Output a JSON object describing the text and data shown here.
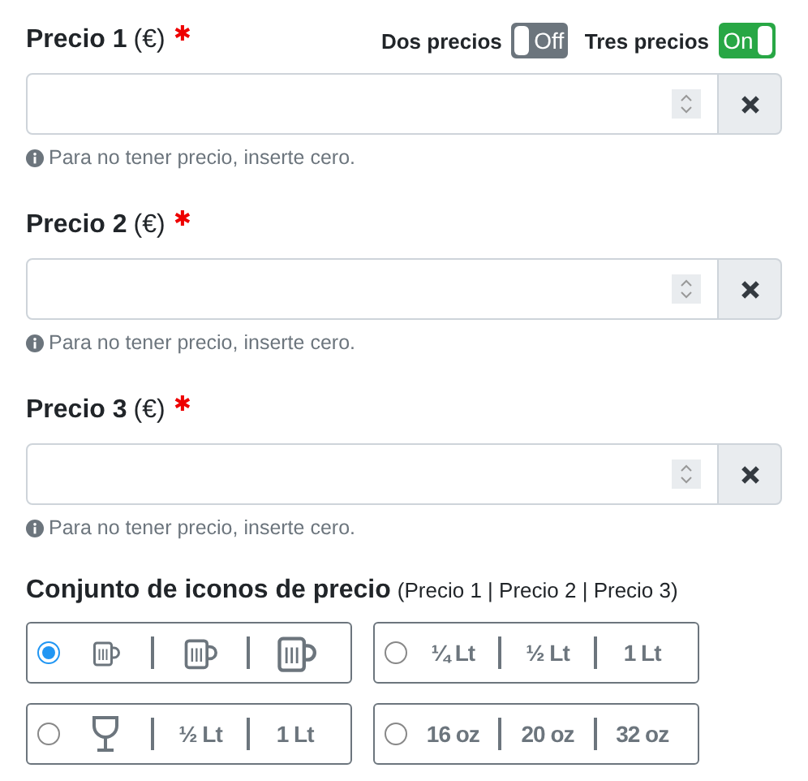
{
  "toggles": [
    {
      "label": "Dos precios",
      "on": false,
      "state_text": "Off"
    },
    {
      "label": "Tres precios",
      "on": true,
      "state_text": "On"
    }
  ],
  "prices": [
    {
      "label": "Precio 1",
      "unit": "(€)",
      "required_mark": "✱",
      "hint": "Para no tener precio, inserte cero."
    },
    {
      "label": "Precio 2",
      "unit": "(€)",
      "required_mark": "✱",
      "hint": "Para no tener precio, inserte cero."
    },
    {
      "label": "Precio 3",
      "unit": "(€)",
      "required_mark": "✱",
      "hint": "Para no tener precio, inserte cero."
    }
  ],
  "icon_sets": {
    "title": "Conjunto de iconos de precio",
    "subtitle": "(Precio 1 | Precio 2 | Precio 3)",
    "options": [
      {
        "selected": true,
        "items": [
          {
            "kind": "small_mug"
          },
          {
            "kind": "medium_mug"
          },
          {
            "kind": "large_mug"
          }
        ]
      },
      {
        "selected": false,
        "items": [
          {
            "kind": "text",
            "text": "¼ Lt"
          },
          {
            "kind": "text",
            "text": "½ Lt"
          },
          {
            "kind": "text",
            "text": "1 Lt"
          }
        ]
      },
      {
        "selected": false,
        "items": [
          {
            "kind": "glass"
          },
          {
            "kind": "text",
            "text": "½ Lt"
          },
          {
            "kind": "text",
            "text": "1 Lt"
          }
        ]
      },
      {
        "selected": false,
        "items": [
          {
            "kind": "text",
            "text": "16 oz"
          },
          {
            "kind": "text",
            "text": "20 oz"
          },
          {
            "kind": "text",
            "text": "32 oz"
          }
        ]
      }
    ]
  }
}
